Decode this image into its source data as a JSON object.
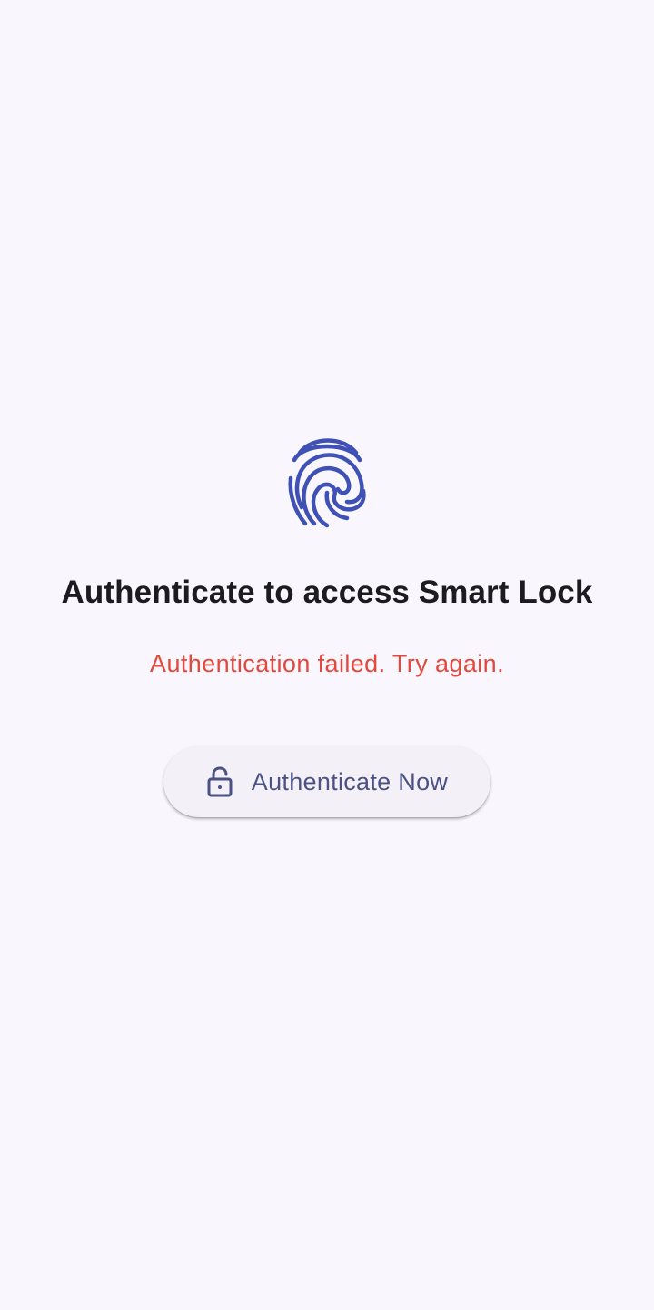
{
  "screen": {
    "title": "Authenticate to access Smart Lock",
    "error_message": "Authentication failed. Try again.",
    "fingerprint_icon": "fingerprint-icon",
    "auth_button": {
      "label": "Authenticate Now",
      "icon": "lock-open-icon"
    }
  },
  "colors": {
    "background": "#f9f7fd",
    "accent": "#3f51b5",
    "error": "#e2483c",
    "button_text": "#4b5185",
    "button_bg": "#f3f0f7",
    "title": "#1c1b1f"
  }
}
